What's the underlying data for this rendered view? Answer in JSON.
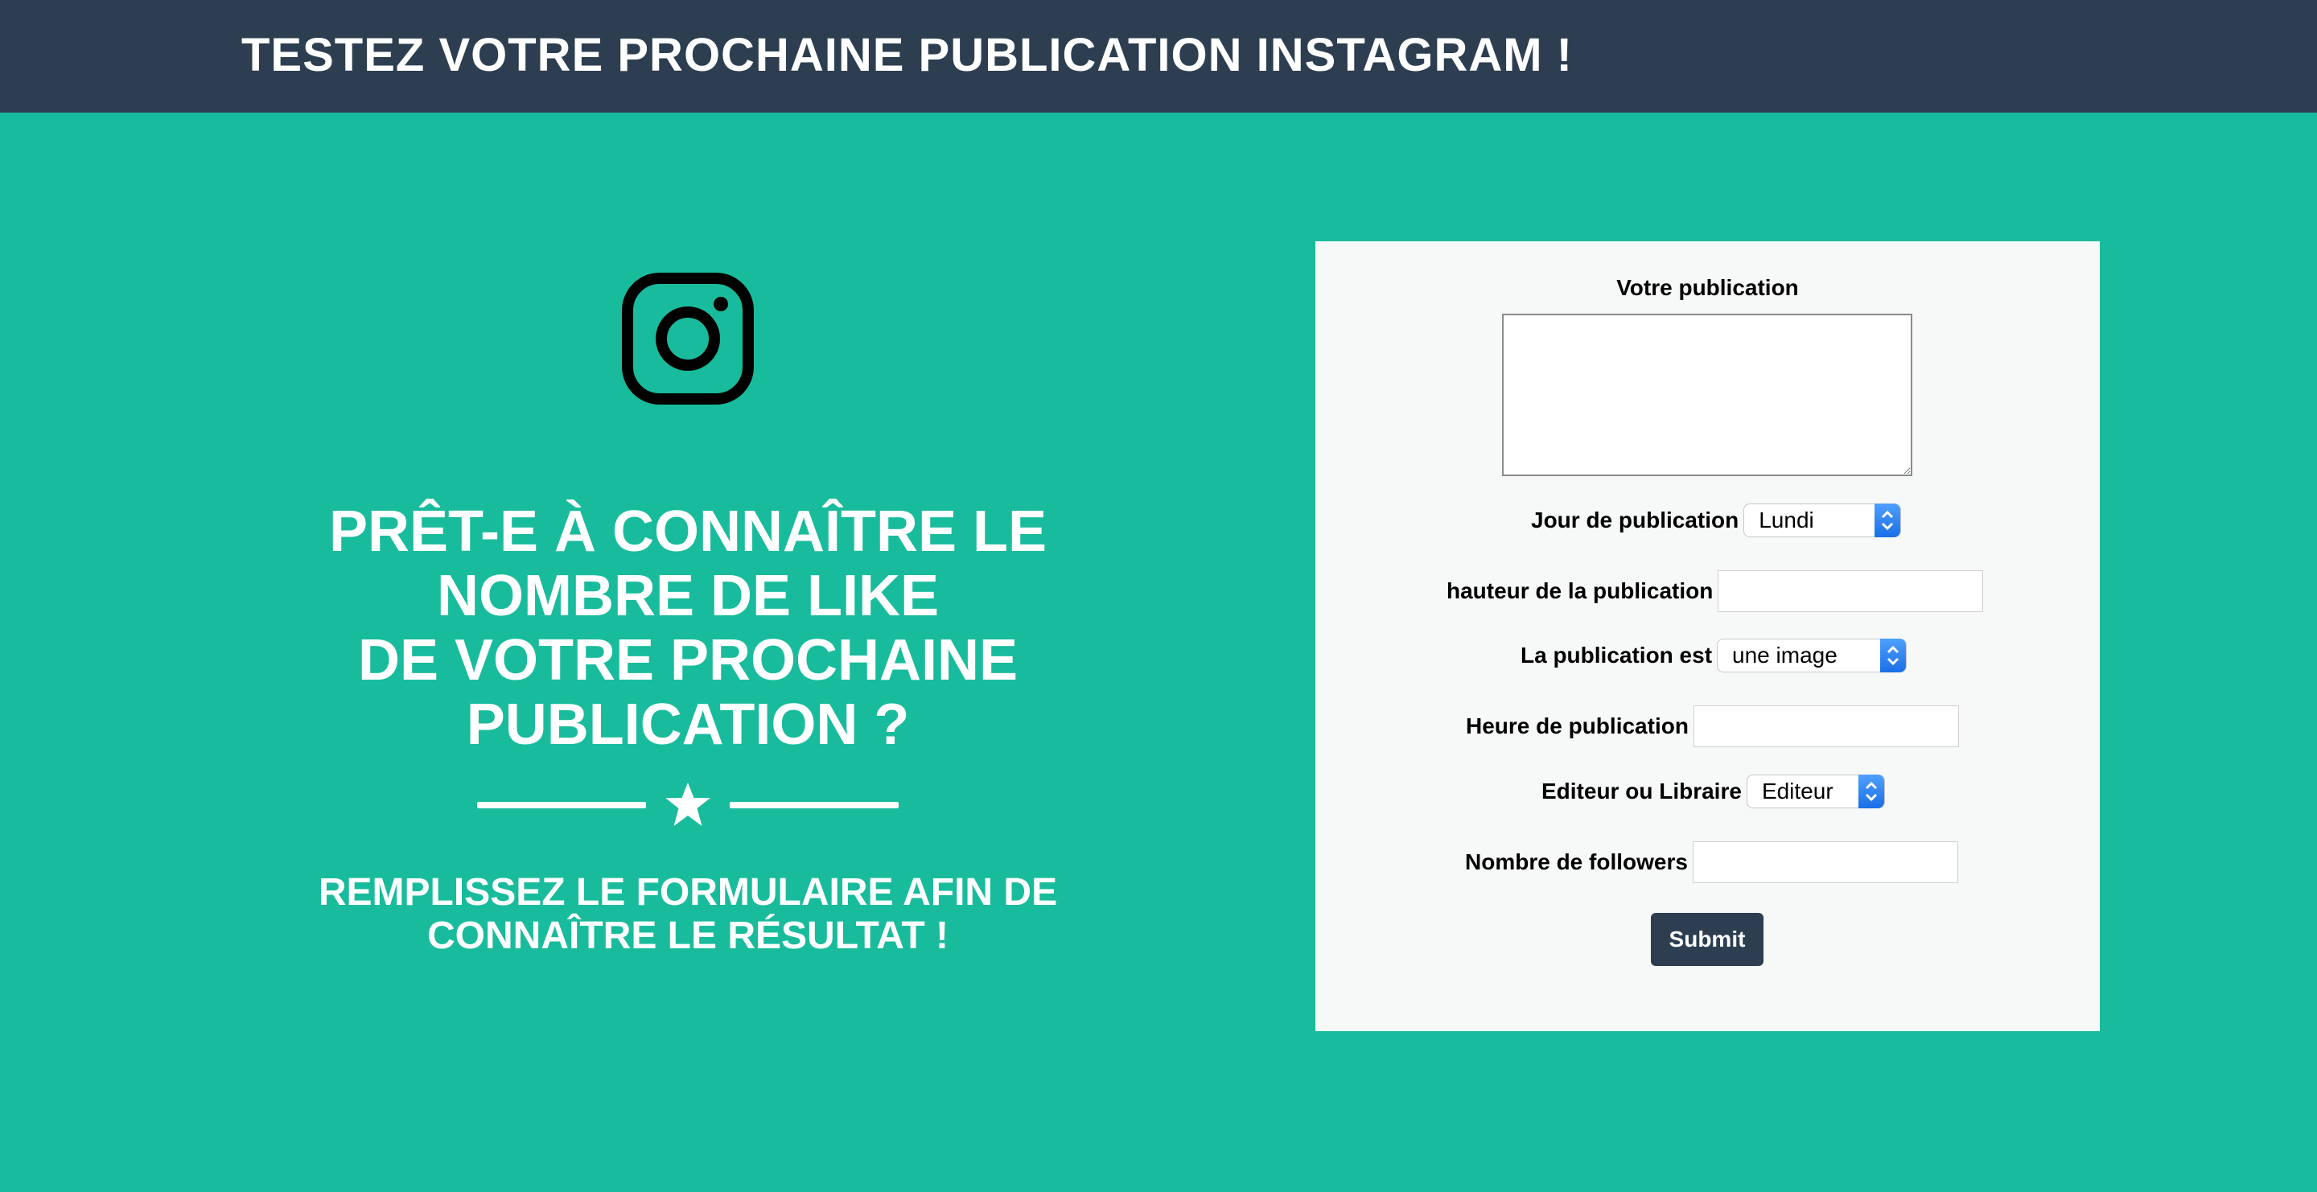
{
  "navbar": {
    "title": "TESTEZ VOTRE PROCHAINE PUBLICATION INSTAGRAM !"
  },
  "hero": {
    "logo_icon": "instagram-icon",
    "headline_lines": [
      "PRÊT-E À CONNAÎTRE LE",
      "NOMBRE DE LIKE",
      "DE VOTRE PROCHAINE",
      "PUBLICATION ?"
    ],
    "divider_icon": "star-icon",
    "subtext_lines": [
      "REMPLISSEZ LE FORMULAIRE AFIN DE",
      "CONNAÎTRE LE RÉSULTAT !"
    ]
  },
  "form": {
    "publication": {
      "label": "Votre publication",
      "value": "",
      "placeholder": ""
    },
    "jour": {
      "label": "Jour de publication",
      "selected": "Lundi"
    },
    "hauteur": {
      "label": "hauteur de la publication",
      "value": ""
    },
    "type": {
      "label": "La publication est",
      "selected": "une image"
    },
    "heure": {
      "label": "Heure de publication",
      "value": ""
    },
    "editeur": {
      "label": "Editeur ou Libraire",
      "selected": "Editeur"
    },
    "followers": {
      "label": "Nombre de followers",
      "value": ""
    },
    "submit_label": "Submit"
  },
  "colors": {
    "navbar_bg": "#2c3e50",
    "page_bg": "#18bc9c",
    "panel_bg": "#f7f8f8",
    "select_arrow": "#2a7ff2"
  }
}
